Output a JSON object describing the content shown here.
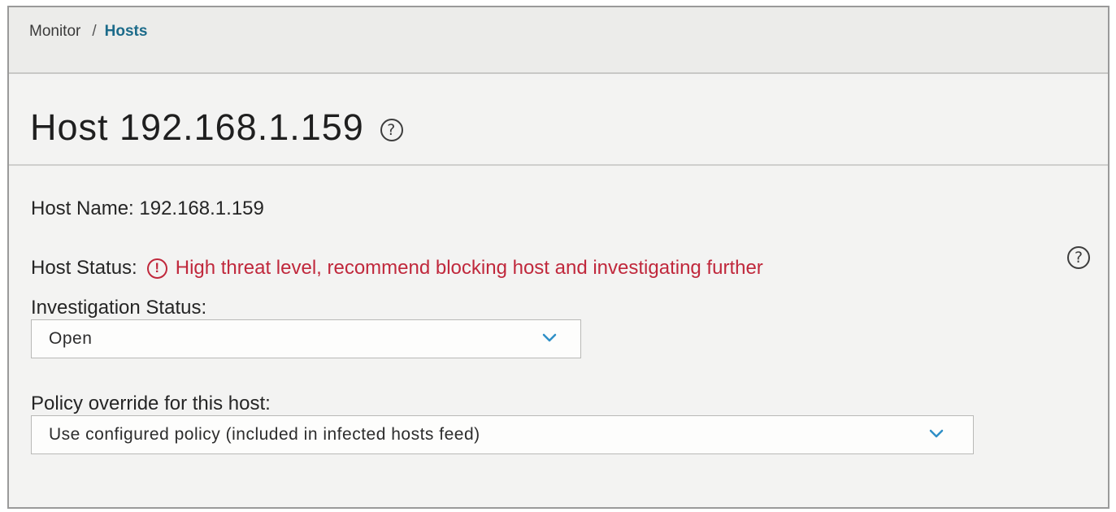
{
  "breadcrumb": {
    "parent": "Monitor",
    "separator": "/",
    "current": "Hosts"
  },
  "page": {
    "title": "Host 192.168.1.159",
    "help_icon": "question-circle-icon"
  },
  "host_name": {
    "label": "Host Name:",
    "value": "192.168.1.159"
  },
  "host_status": {
    "label": "Host Status:",
    "icon": "alert-circle-icon",
    "text": "High threat level, recommend blocking host and investigating further",
    "help_icon": "question-circle-icon",
    "color": "#c0283c"
  },
  "investigation_status": {
    "label": "Investigation Status:",
    "selected": "Open",
    "icon": "chevron-down-icon"
  },
  "policy_override": {
    "label": "Policy override for this host:",
    "selected": "Use configured policy (included in infected hosts feed)",
    "icon": "chevron-down-icon"
  },
  "colors": {
    "accent": "#1c6b8a",
    "chevron": "#2f8fc7",
    "alert": "#c0283c"
  }
}
